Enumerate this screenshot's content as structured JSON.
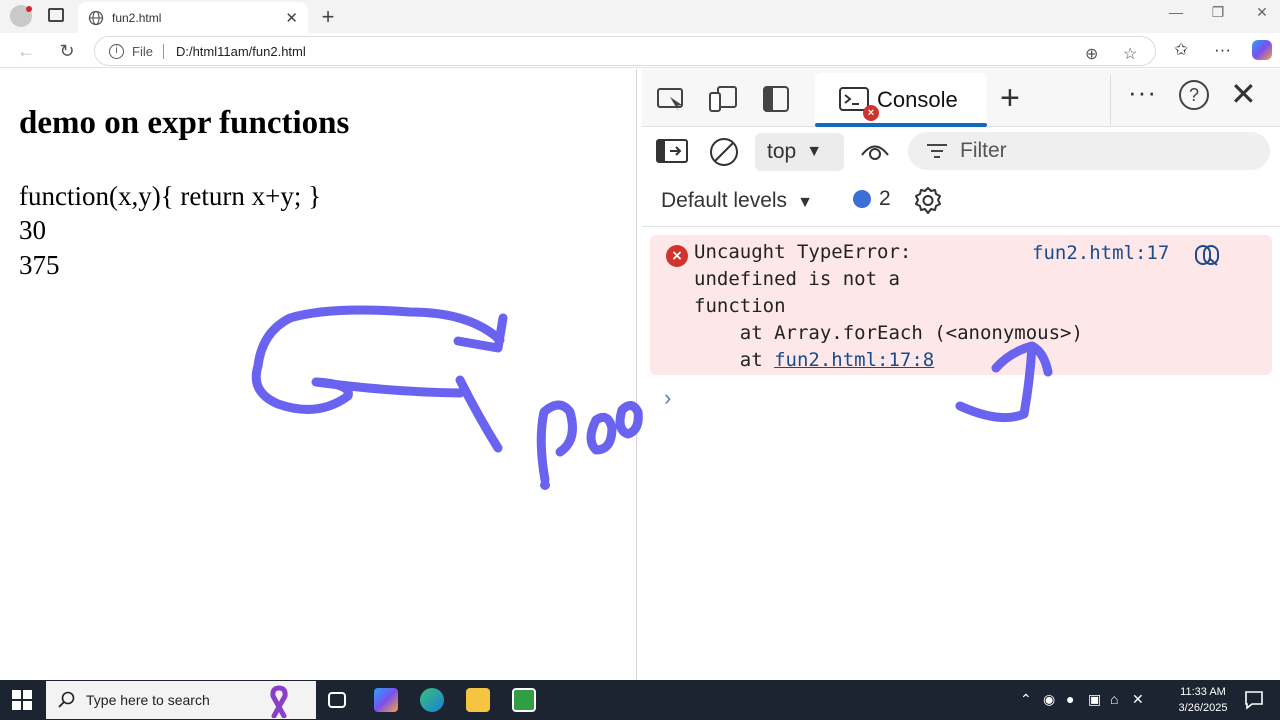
{
  "browser": {
    "tab_title": "fun2.html",
    "file_label": "File",
    "address": "D:/html11am/fun2.html"
  },
  "page": {
    "heading": "demo on expr functions",
    "lines": [
      "function(x,y){ return x+y; }",
      "30",
      "375"
    ]
  },
  "devtools": {
    "console_tab_label": "Console",
    "context_select": "top",
    "filter_placeholder": "Filter",
    "levels_label": "Default levels",
    "message_count": "2",
    "error": {
      "line1": "Uncaught TypeError:",
      "line2": "undefined is not a",
      "line3": "function",
      "line4": "    at Array.forEach (<anonymous>)",
      "line5_prefix": "    at ",
      "line5_link": "fun2.html:17:8",
      "source_link": "fun2.html:17"
    },
    "prompt_symbol": "›"
  },
  "taskbar": {
    "search_placeholder": "Type here to search",
    "time": "11:33 AM",
    "date": "3/26/2025"
  },
  "colors": {
    "annotation_ink": "#6a63f0",
    "error_bg": "#fde7e9",
    "accent": "#0f6cbd",
    "taskbar_bg": "#1c2432"
  }
}
